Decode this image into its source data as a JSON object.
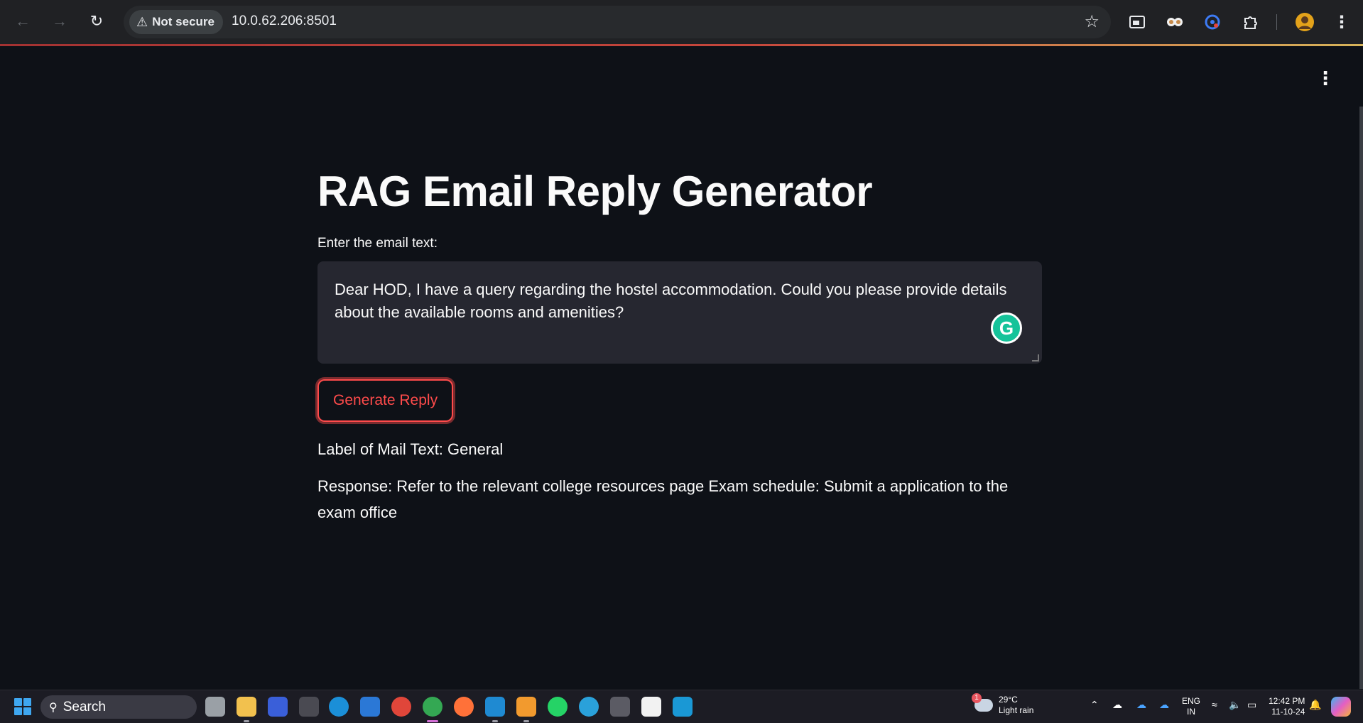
{
  "browser": {
    "security_label": "Not secure",
    "url": "10.0.62.206:8501"
  },
  "app": {
    "title": "RAG Email Reply Generator",
    "email_label": "Enter the email text:",
    "email_value": "Dear HOD, I have a query regarding the hostel accommodation. Could you please provide details about the available rooms and amenities?",
    "generate_button": "Generate Reply",
    "label_result": "Label of Mail Text: General",
    "response": "Response: Refer to the relevant college resources page Exam schedule: Submit a application to the exam office"
  },
  "taskbar": {
    "search_label": "Search",
    "weather_temp": "29°C",
    "weather_desc": "Light rain",
    "weather_badge": "1",
    "lang_top": "ENG",
    "lang_bottom": "IN",
    "time": "12:42 PM",
    "date": "11-10-24"
  },
  "colors": {
    "accent": "#ff4b4b",
    "background": "#0e1117",
    "input_bg": "#262730"
  }
}
